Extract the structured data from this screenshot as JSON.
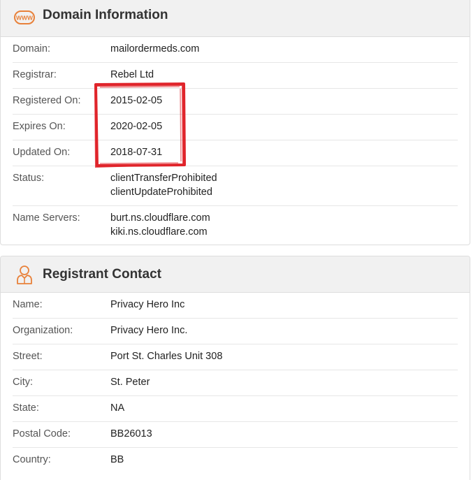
{
  "domain_panel": {
    "title": "Domain Information",
    "icon": "www-icon",
    "rows": [
      {
        "label": "Domain:",
        "values": [
          "mailordermeds.com"
        ]
      },
      {
        "label": "Registrar:",
        "values": [
          "Rebel Ltd"
        ]
      },
      {
        "label": "Registered On:",
        "values": [
          "2015-02-05"
        ]
      },
      {
        "label": "Expires On:",
        "values": [
          "2020-02-05"
        ]
      },
      {
        "label": "Updated On:",
        "values": [
          "2018-07-31"
        ]
      },
      {
        "label": "Status:",
        "values": [
          "clientTransferProhibited",
          "clientUpdateProhibited"
        ]
      },
      {
        "label": "Name Servers:",
        "values": [
          "burt.ns.cloudflare.com",
          "kiki.ns.cloudflare.com"
        ]
      }
    ]
  },
  "registrant_panel": {
    "title": "Registrant Contact",
    "icon": "person-icon",
    "rows": [
      {
        "label": "Name:",
        "values": [
          "Privacy Hero Inc"
        ]
      },
      {
        "label": "Organization:",
        "values": [
          "Privacy Hero Inc."
        ]
      },
      {
        "label": "Street:",
        "values": [
          "Port St. Charles Unit 308"
        ]
      },
      {
        "label": "City:",
        "values": [
          "St. Peter"
        ]
      },
      {
        "label": "State:",
        "values": [
          "NA"
        ]
      },
      {
        "label": "Postal Code:",
        "values": [
          "BB26013"
        ]
      },
      {
        "label": "Country:",
        "values": [
          "BB"
        ]
      }
    ]
  },
  "colors": {
    "accent_icon": "#e8813a",
    "highlight": "#e0242b",
    "header_bg": "#f1f1f1"
  }
}
